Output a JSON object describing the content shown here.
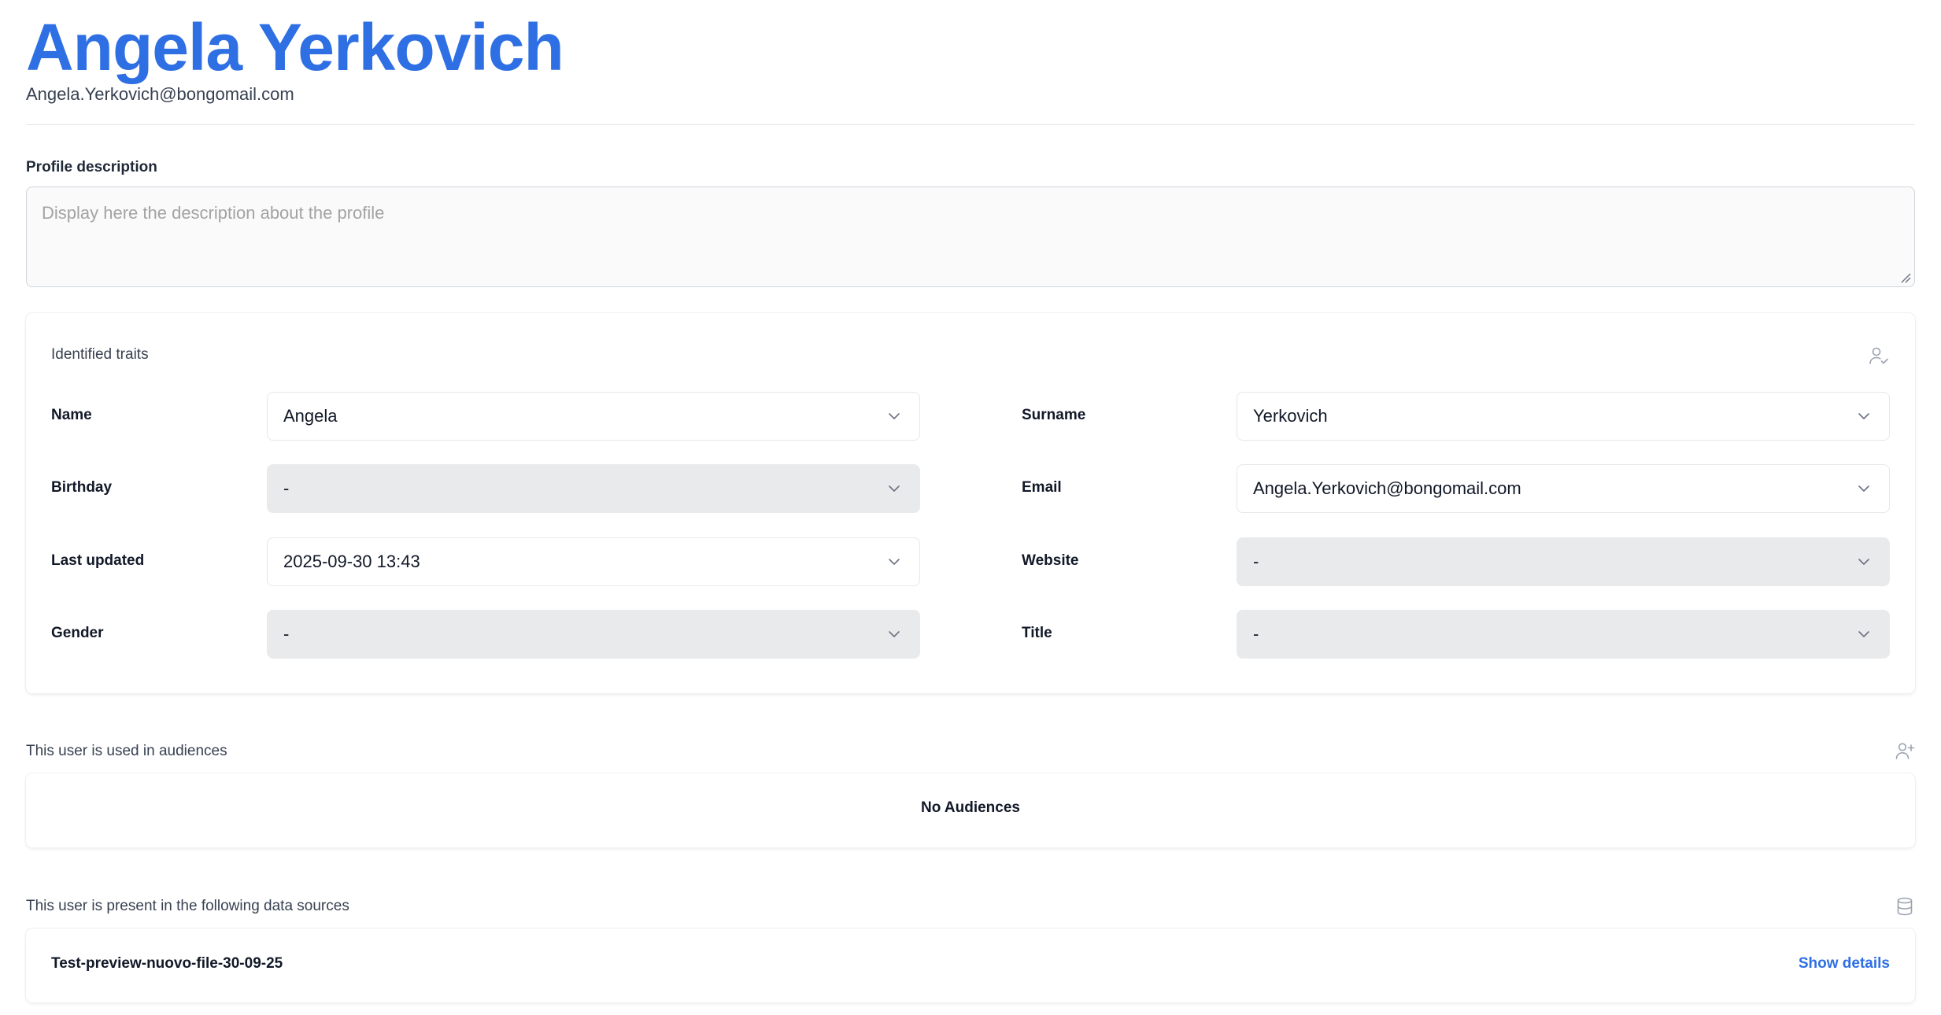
{
  "profile": {
    "full_name": "Angela Yerkovich",
    "email": "Angela.Yerkovich@bongomail.com"
  },
  "description": {
    "label": "Profile description",
    "placeholder": "Display here the description about the profile"
  },
  "traits": {
    "heading": "Identified traits",
    "fields": {
      "name": {
        "label": "Name",
        "value": "Angela"
      },
      "surname": {
        "label": "Surname",
        "value": "Yerkovich"
      },
      "birthday": {
        "label": "Birthday",
        "value": "-"
      },
      "email": {
        "label": "Email",
        "value": "Angela.Yerkovich@bongomail.com"
      },
      "last_updated": {
        "label": "Last updated",
        "value": "2025-09-30 13:43"
      },
      "website": {
        "label": "Website",
        "value": "-"
      },
      "gender": {
        "label": "Gender",
        "value": "-"
      },
      "title": {
        "label": "Title",
        "value": "-"
      }
    },
    "icon": "user-check-icon"
  },
  "audiences": {
    "title": "This user is used in audiences",
    "empty_text": "No Audiences",
    "icon": "user-plus-icon"
  },
  "data_sources": {
    "title": "This user is present in the following data sources",
    "icon": "database-icon",
    "items": [
      {
        "name": "Test-preview-nuovo-file-30-09-25",
        "action": "Show details"
      }
    ]
  },
  "colors": {
    "accent": "#2f6fe4",
    "disabled_field": "#e9eaec"
  }
}
